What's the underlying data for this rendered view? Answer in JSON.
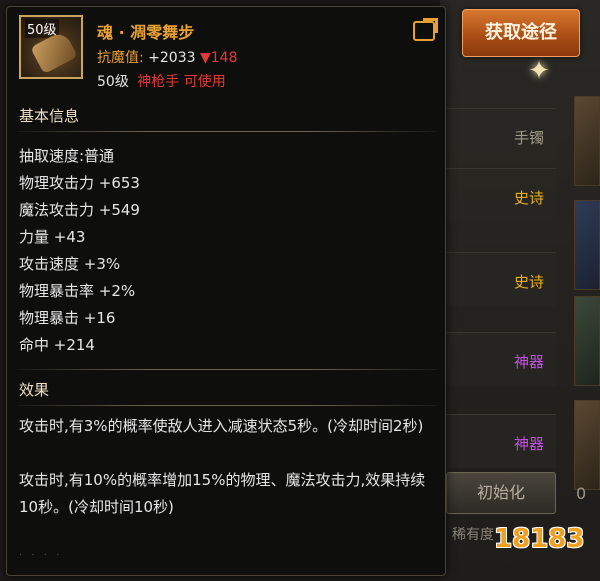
{
  "get_button": "获取途径",
  "background": {
    "rows": [
      {
        "label": "手镯",
        "color": "#a09a8a"
      },
      {
        "label": "史诗",
        "color": "#e8b020"
      },
      {
        "label": "史诗",
        "color": "#e8b020"
      },
      {
        "label": "神器",
        "color": "#c050e0"
      },
      {
        "label": "神器",
        "color": "#c050e0"
      }
    ],
    "button": "初始化",
    "bottom_label": "稀有度",
    "edge_number": "0"
  },
  "item": {
    "icon_level": "50级",
    "name": "魂 · 凋零舞步",
    "resistance_label": "抗魔值:",
    "resistance_value": "+2033",
    "resistance_diff": "▼148",
    "required_level": "50级",
    "class_usable": "神枪手 可使用"
  },
  "basic": {
    "heading": "基本信息",
    "stats": [
      "抽取速度:普通",
      "物理攻击力 +653",
      "魔法攻击力 +549",
      "力量 +43",
      "攻击速度 +3%",
      "物理暴击率 +2%",
      "物理暴击 +16",
      "命中 +214"
    ]
  },
  "effect": {
    "heading": "效果",
    "lines": [
      "攻击时,有3%的概率使敌人进入减速状态5秒。(冷却时间2秒)",
      "攻击时,有10%的概率增加15%的物理、魔法攻击力,效果持续10秒。(冷却时间10秒)"
    ]
  },
  "watermark": "18183"
}
